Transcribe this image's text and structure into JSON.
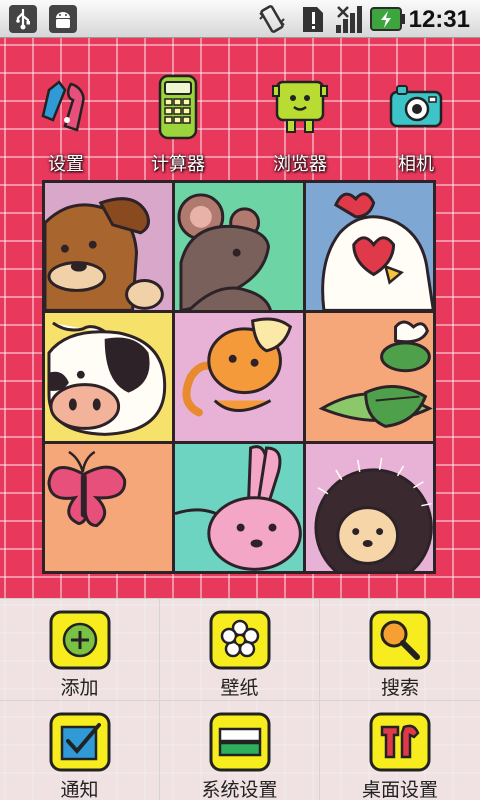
{
  "status_bar": {
    "time": "12:31",
    "icons": [
      "usb-icon",
      "android-debug-icon",
      "vibrate-icon",
      "sim-alert-icon",
      "signal-icon",
      "battery-charging-icon"
    ]
  },
  "home": {
    "apps": [
      {
        "label": "设置",
        "icon": "settings-tools-icon"
      },
      {
        "label": "计算器",
        "icon": "calculator-icon"
      },
      {
        "label": "浏览器",
        "icon": "browser-icon"
      },
      {
        "label": "相机",
        "icon": "camera-icon"
      }
    ],
    "puzzle": {
      "tiles": [
        "dog",
        "mouse",
        "chicken",
        "cow",
        "monkey",
        "frog",
        "butterfly",
        "rabbit",
        "hedgehog"
      ]
    }
  },
  "menu": {
    "items": [
      {
        "label": "添加",
        "icon": "add-icon"
      },
      {
        "label": "壁纸",
        "icon": "wallpaper-flower-icon"
      },
      {
        "label": "搜索",
        "icon": "search-icon"
      },
      {
        "label": "通知",
        "icon": "notification-check-icon"
      },
      {
        "label": "系统设置",
        "icon": "system-settings-icon"
      },
      {
        "label": "桌面设置",
        "icon": "desktop-settings-tools-icon"
      }
    ]
  },
  "colors": {
    "wallpaper": "#e8385c",
    "menu_icon_bg": "#f7ec1e",
    "battery_green": "#3da53d"
  }
}
